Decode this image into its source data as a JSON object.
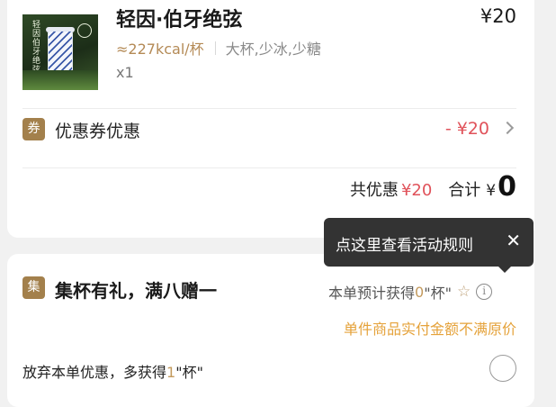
{
  "order": {
    "product": {
      "image_text": "轻因伯牙绝弦",
      "name": "轻因·伯牙绝弦",
      "price": "¥20",
      "calories": "≈227kcal/杯",
      "options": "大杯,少冰,少糖",
      "quantity": "x1"
    },
    "coupon": {
      "tag": "券",
      "label": "优惠券优惠",
      "value": "- ¥20"
    },
    "summary": {
      "discount_label": "共优惠",
      "discount_value": "¥20",
      "total_label": "合计",
      "currency": "¥",
      "total_value": "0"
    }
  },
  "tooltip": {
    "text": "点这里查看活动规则",
    "close": "✕"
  },
  "collect": {
    "tag": "集",
    "title": "集杯有礼，满八赠一",
    "estimate_prefix": "本单预计获得",
    "estimate_count": "0",
    "estimate_suffix": "\"杯\"",
    "warning": "单件商品实付金额不满原价",
    "abandon_prefix": "放弃本单优惠，多获得",
    "abandon_count": "1",
    "abandon_suffix": "\"杯\""
  }
}
